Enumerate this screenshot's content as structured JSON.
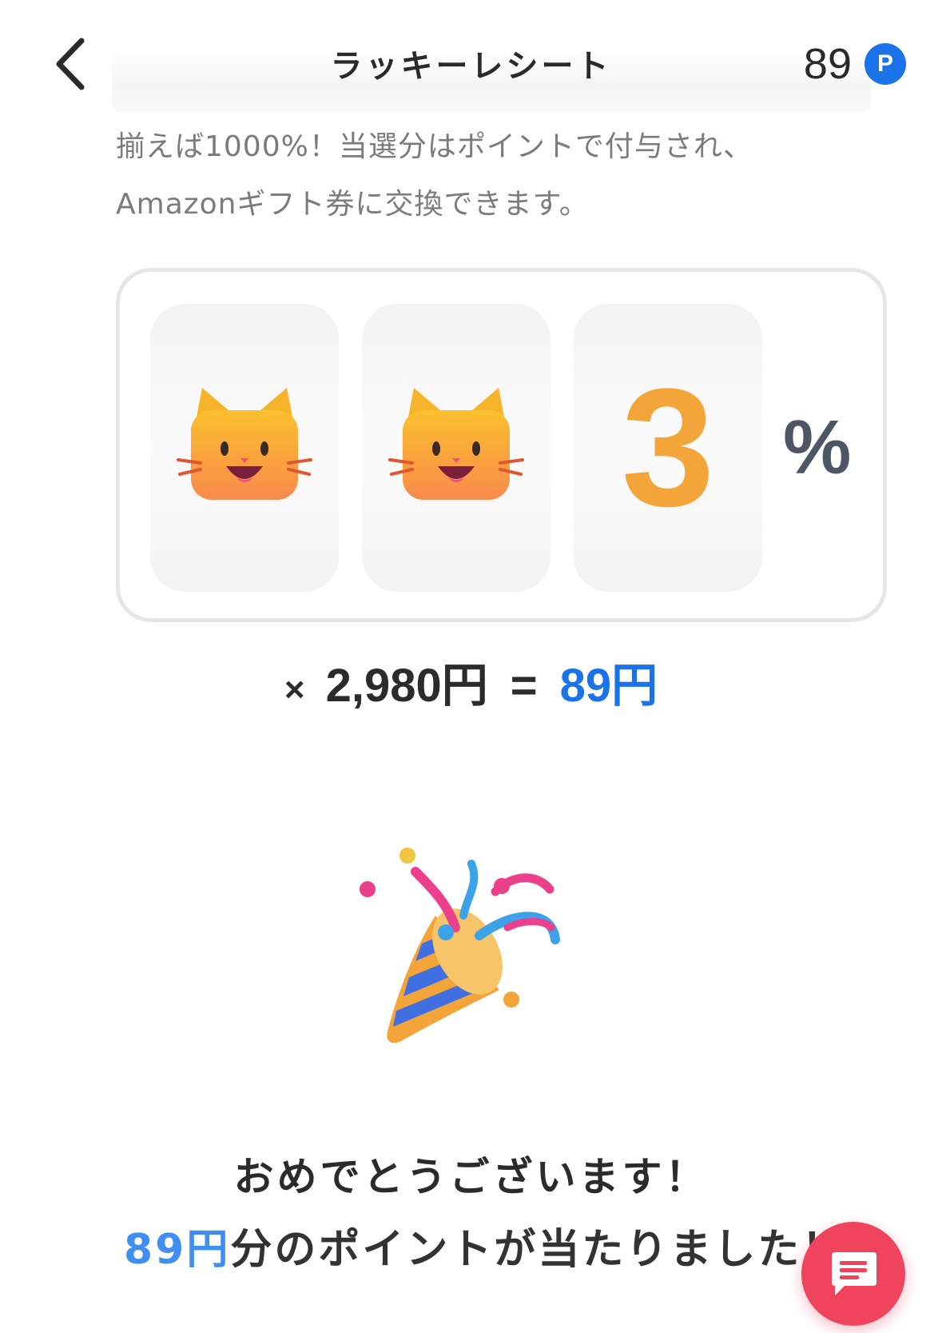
{
  "header": {
    "title": "ラッキーレシート",
    "points_value": "89",
    "points_badge": "P",
    "back_icon": "chevron-left-icon"
  },
  "description": {
    "line1": "揃えば1000%！当選分はポイントで付与され、",
    "line2": "Amazonギフト券に交換できます。"
  },
  "slot": {
    "reels": [
      {
        "icon": "cat-face-icon"
      },
      {
        "icon": "cat-face-icon"
      },
      {
        "digit": "3"
      }
    ],
    "percent_sign": "%"
  },
  "calculation": {
    "times": "×",
    "amount": "2,980円",
    "equals": "=",
    "result": "89円"
  },
  "celebration": {
    "icon": "party-popper-icon",
    "heading": "おめでとうございます！",
    "won_amount": "89円",
    "won_text": "分のポイントが当たりました！"
  },
  "chat_button": {
    "icon": "chat-icon"
  },
  "colors": {
    "accent_blue": "#1a73e8",
    "digit_orange": "#f4a53a",
    "chat_red": "#f0445d"
  }
}
